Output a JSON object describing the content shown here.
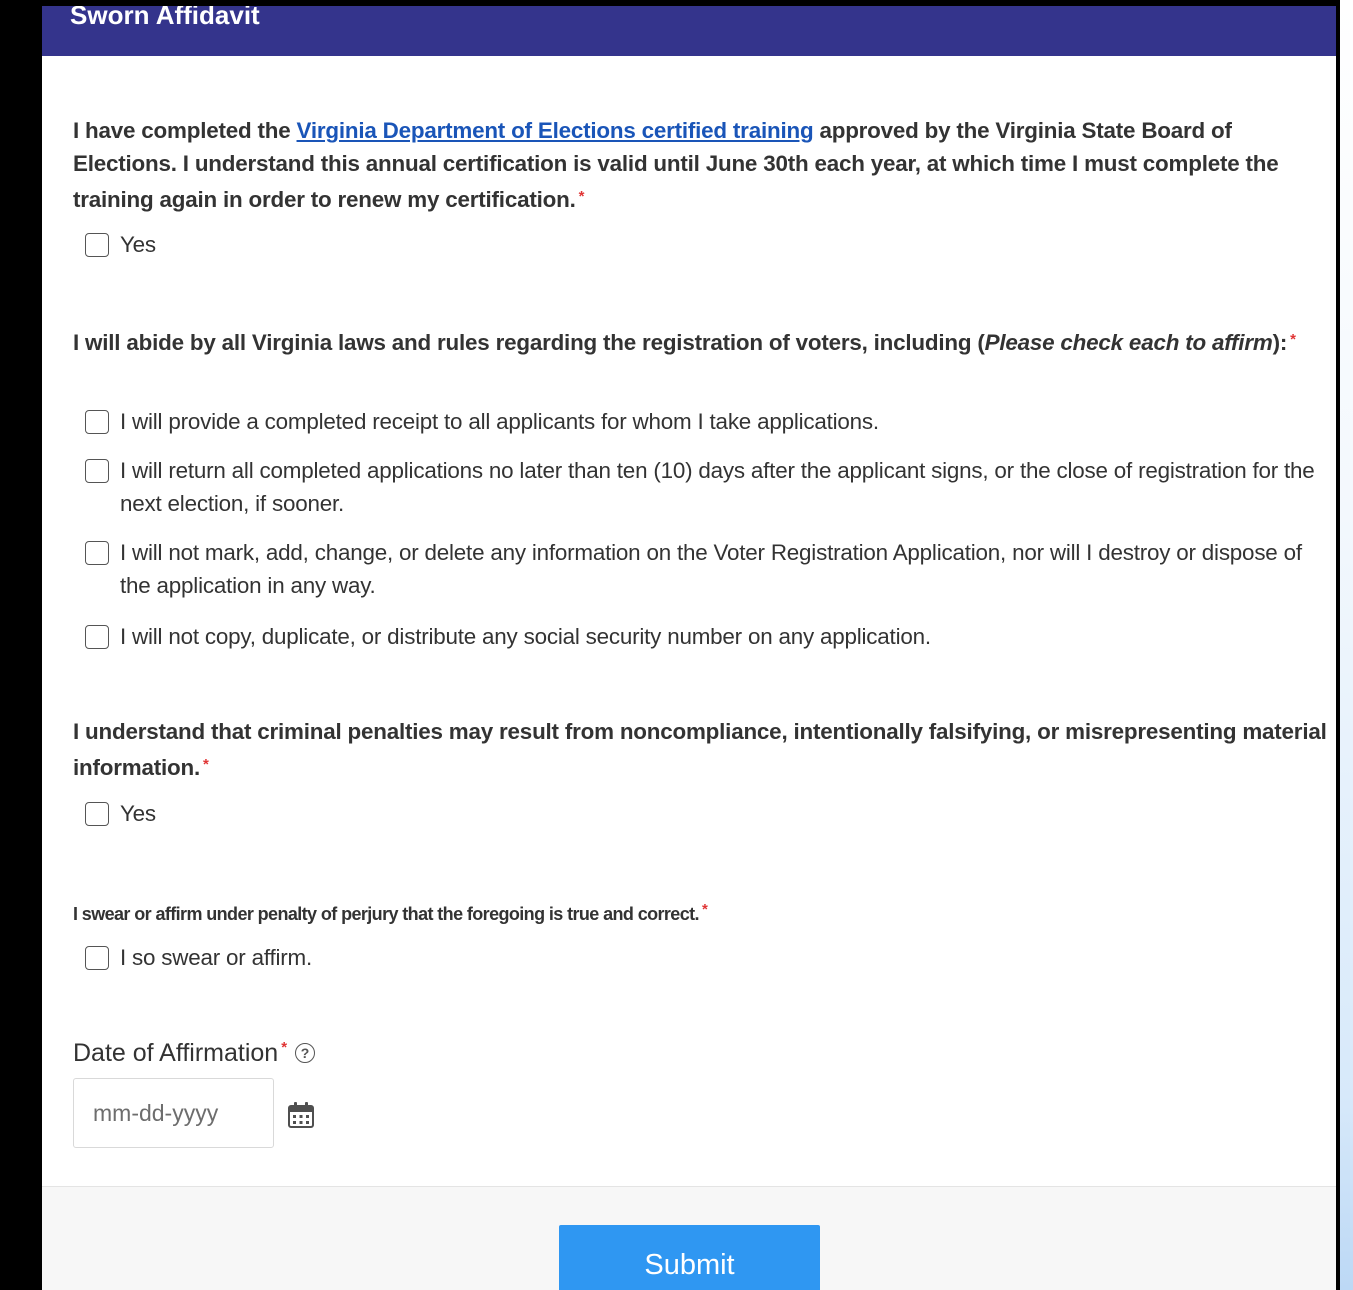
{
  "header": {
    "title": "Sworn Affidavit"
  },
  "questions": {
    "training": {
      "text_before": "I have completed the ",
      "link_text": "Virginia Department of Elections certified training",
      "text_after": " approved by the Virginia State Board of Elections. I understand this annual certification is valid until June 30th each year, at which time I must complete the training again in order to renew my certification.",
      "required_mark": "*",
      "options": [
        "Yes"
      ]
    },
    "laws": {
      "text_before": "I will abide by all Virginia laws and rules regarding the registration of voters, including (",
      "italic_text": "Please check each to affirm",
      "text_after": "):",
      "required_mark": "*",
      "options": [
        "I will provide a completed receipt to all applicants for whom I take applications.",
        "I will return all completed applications no later than ten (10) days after the applicant signs, or the close of registration for the next election, if sooner.",
        "I will not mark, add, change, or delete any information on the Voter Registration Application, nor will I destroy or dispose of the application in any way.",
        "I will not copy, duplicate, or distribute any social security number on any application."
      ]
    },
    "penalties": {
      "text": "I understand that criminal penalties may result from noncompliance, intentionally falsifying, or misrepresenting material information.",
      "required_mark": "*",
      "options": [
        "Yes"
      ]
    },
    "perjury": {
      "text": "I swear or affirm under penalty of perjury that the foregoing is true and correct.",
      "required_mark": "*",
      "options": [
        "I so swear or affirm."
      ]
    }
  },
  "date_field": {
    "label": "Date of Affirmation",
    "required_mark": "*",
    "help_icon": "?",
    "placeholder": "mm-dd-yyyy",
    "value": ""
  },
  "icons": {
    "help": "question-circle-icon",
    "calendar": "calendar-icon"
  },
  "colors": {
    "header_bg": "#34348c",
    "link": "#1a55b8",
    "required": "#e03535",
    "submit_bg": "#2f97f2",
    "text": "#333333"
  },
  "footer": {
    "submit_label": "Submit"
  }
}
